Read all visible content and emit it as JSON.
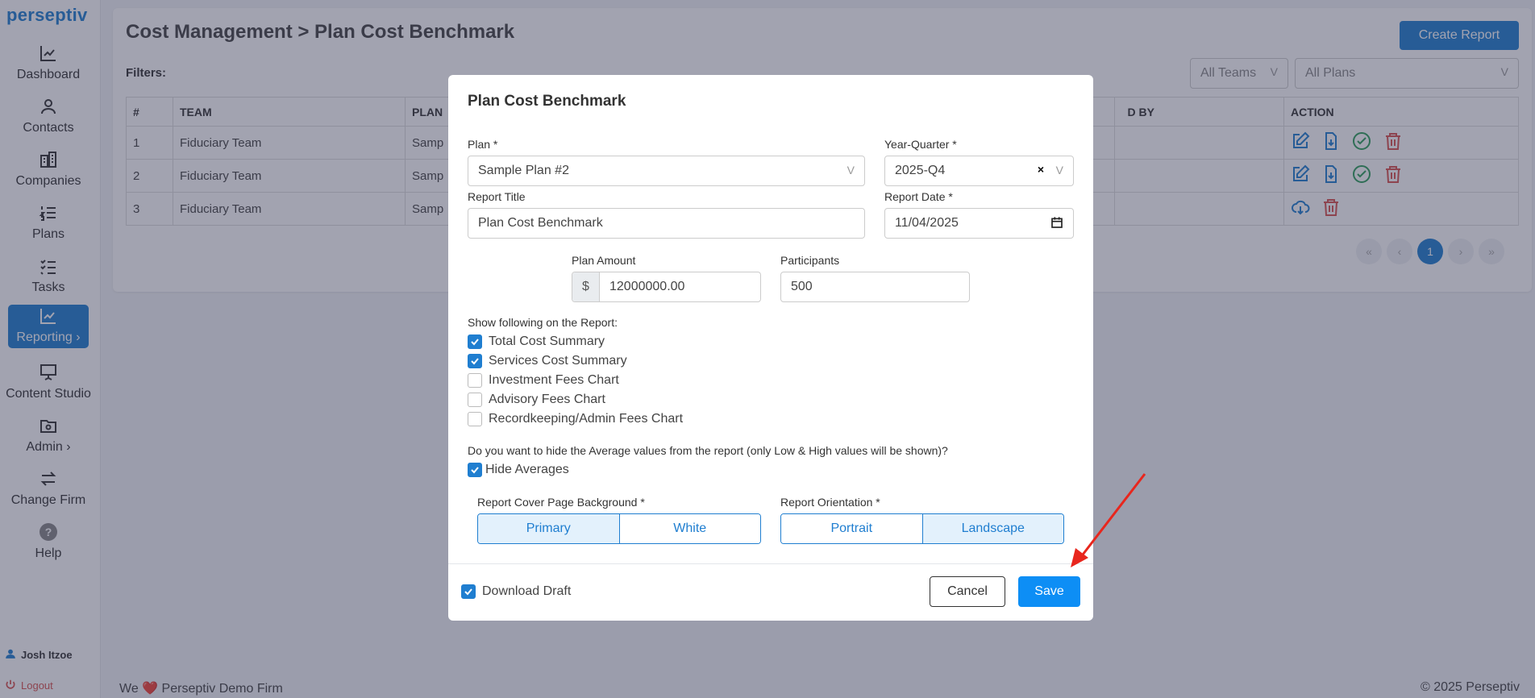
{
  "brand": {
    "logo": "perseptiv"
  },
  "sidebar": {
    "items": [
      {
        "label": "Dashboard"
      },
      {
        "label": "Contacts"
      },
      {
        "label": "Companies"
      },
      {
        "label": "Plans"
      },
      {
        "label": "Tasks"
      },
      {
        "label": "Reporting",
        "suffix": "›"
      },
      {
        "label": "Content Studio"
      },
      {
        "label": "Admin",
        "suffix": "›"
      },
      {
        "label": "Change Firm"
      },
      {
        "label": "Help"
      }
    ],
    "user": "Josh Itzoe",
    "logout": "Logout"
  },
  "page": {
    "title": "Cost Management > Plan Cost Benchmark",
    "create_button": "Create Report",
    "filters_label": "Filters:",
    "filter_teams": "All Teams",
    "filter_plans": "All Plans",
    "table": {
      "headers": [
        "#",
        "TEAM",
        "PLAN",
        "D BY",
        "ACTION"
      ],
      "rows": [
        {
          "num": "1",
          "team": "Fiduciary Team",
          "plan": "Samp"
        },
        {
          "num": "2",
          "team": "Fiduciary Team",
          "plan": "Samp"
        },
        {
          "num": "3",
          "team": "Fiduciary Team",
          "plan": "Samp"
        }
      ]
    },
    "pagination": {
      "first": "«",
      "prev": "‹",
      "current": "1",
      "next": "›",
      "last": "»"
    }
  },
  "footer": {
    "left_prefix": "We",
    "left_suffix": "Perseptiv Demo Firm",
    "right": "© 2025 Perseptiv"
  },
  "modal": {
    "title": "Plan Cost Benchmark",
    "plan_label": "Plan *",
    "plan_value": "Sample Plan #2",
    "yq_label": "Year-Quarter *",
    "yq_value": "2025-Q4",
    "report_title_label": "Report Title",
    "report_title_value": "Plan Cost Benchmark",
    "report_date_label": "Report Date *",
    "report_date_value": "11/04/2025",
    "plan_amount_label": "Plan Amount",
    "currency": "$",
    "plan_amount_value": "12000000.00",
    "participants_label": "Participants",
    "participants_value": "500",
    "show_label": "Show following on the Report:",
    "options": [
      {
        "label": "Total Cost Summary",
        "checked": true
      },
      {
        "label": "Services Cost Summary",
        "checked": true
      },
      {
        "label": "Investment Fees Chart",
        "checked": false
      },
      {
        "label": "Advisory Fees Chart",
        "checked": false
      },
      {
        "label": "Recordkeeping/Admin Fees Chart",
        "checked": false
      }
    ],
    "hide_question": "Do you want to hide the Average values from the report (only Low & High values will be shown)?",
    "hide_averages": "Hide Averages",
    "cover_label": "Report Cover Page Background *",
    "cover_options": [
      "Primary",
      "White"
    ],
    "cover_selected": "Primary",
    "orientation_label": "Report Orientation *",
    "orientation_options": [
      "Portrait",
      "Landscape"
    ],
    "orientation_selected": "Landscape",
    "download_draft": "Download Draft",
    "cancel": "Cancel",
    "save": "Save"
  },
  "colors": {
    "accent": "#1f7ed0",
    "save": "#0d8ef5",
    "annotation_arrow": "#e8261d"
  }
}
